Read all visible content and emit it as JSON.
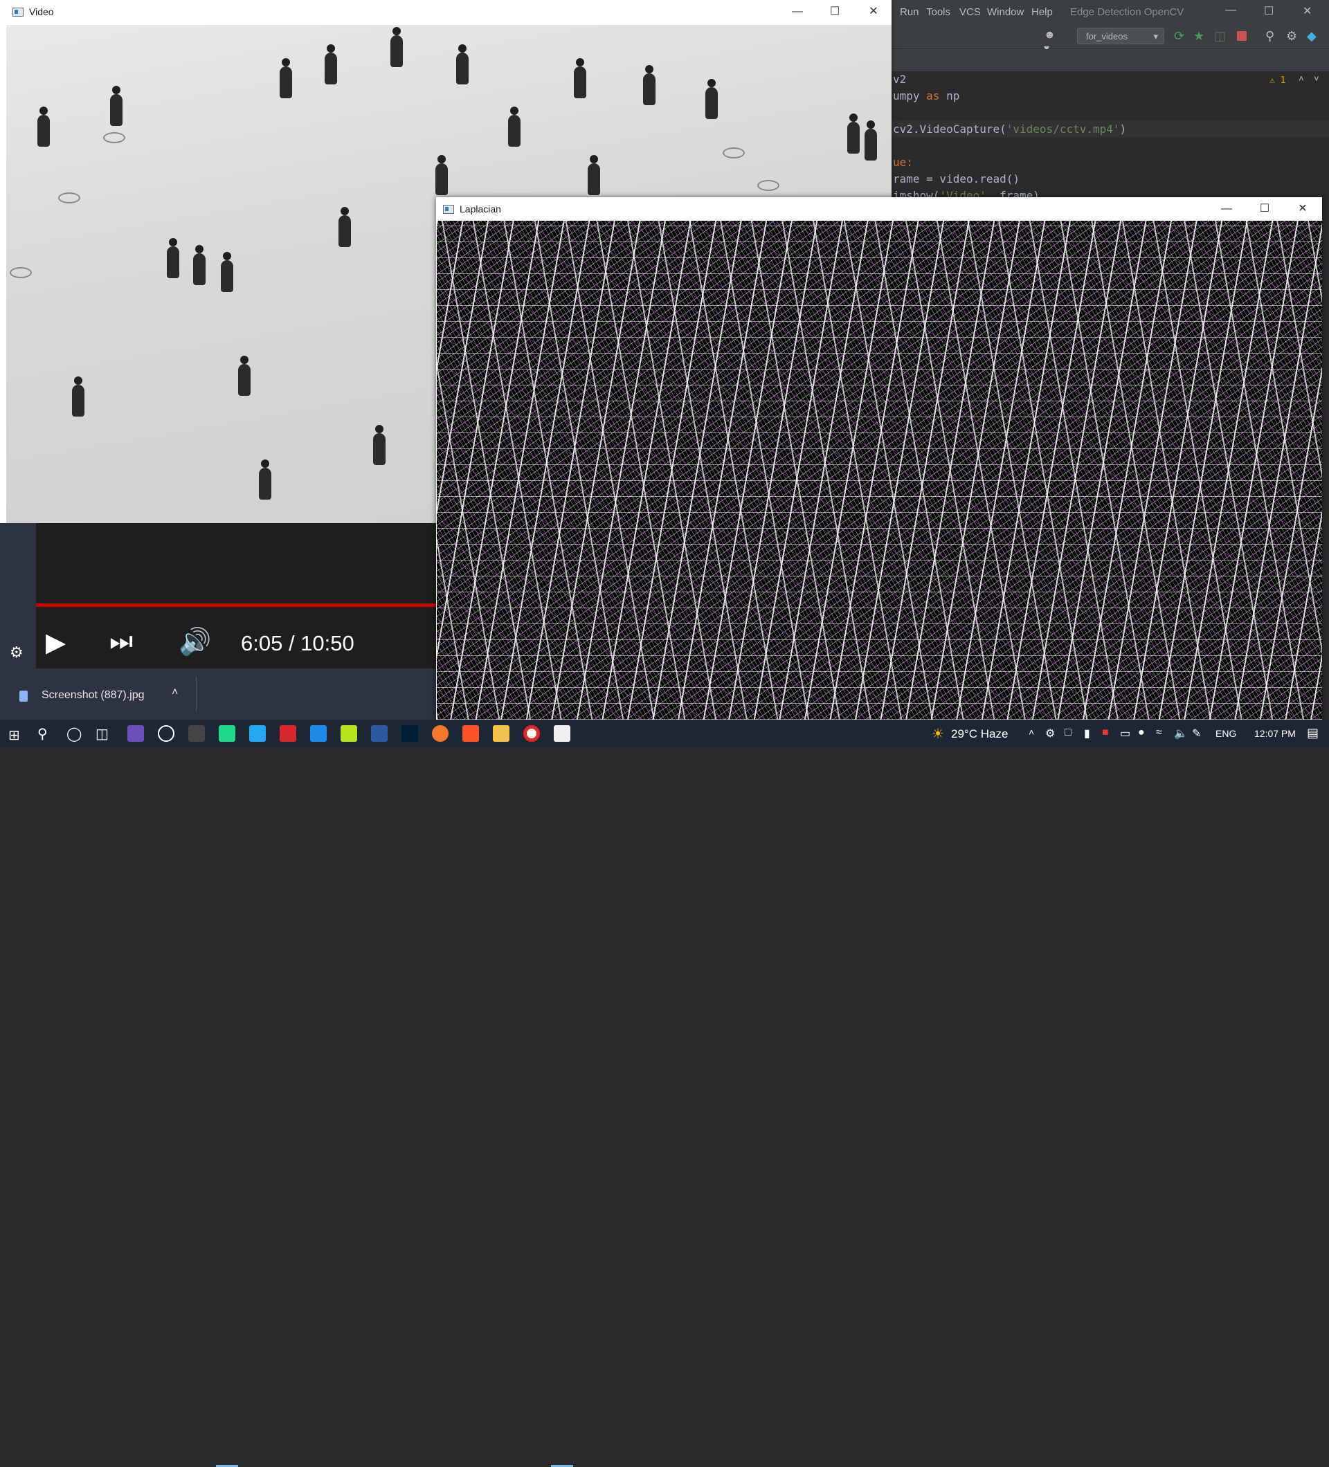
{
  "ide": {
    "menu": [
      "Run",
      "Tools",
      "VCS",
      "Window",
      "Help"
    ],
    "project_title": "Edge Detection OpenCV",
    "run_config": "for_videos",
    "warning_count": "1",
    "code_lines": [
      {
        "pre": "v2",
        "kw": "",
        "str": "",
        "post": ""
      },
      {
        "pre": "umpy ",
        "kw": "as",
        "str": "",
        "post": " np"
      },
      {
        "pre": "",
        "kw": "",
        "str": "",
        "post": ""
      },
      {
        "pre": "cv2.VideoCapture(",
        "kw": "",
        "str": "'videos/cctv.mp4'",
        "post": ")"
      },
      {
        "pre": "",
        "kw": "",
        "str": "",
        "post": ""
      },
      {
        "pre": "",
        "kw": "ue:",
        "str": "",
        "post": ""
      },
      {
        "pre": "rame = video.read()",
        "kw": "",
        "str": "",
        "post": ""
      },
      {
        "pre": "imshow(",
        "kw": "",
        "str": "'Video'",
        "post": ", frame)"
      }
    ]
  },
  "video_window": {
    "title": "Video"
  },
  "player": {
    "time": "6:05 / 10:50",
    "progress": 1.0
  },
  "downloads": {
    "file": "Screenshot (887).jpg"
  },
  "laplacian_window": {
    "title": "Laplacian"
  },
  "taskbar": {
    "weather": "29°C  Haze",
    "language": "ENG",
    "clock": "12:07 PM"
  },
  "colors": {
    "progress_red": "#cc0000",
    "taskbar_bg": "#1d2633",
    "ide_bg": "#2b2b2b"
  }
}
